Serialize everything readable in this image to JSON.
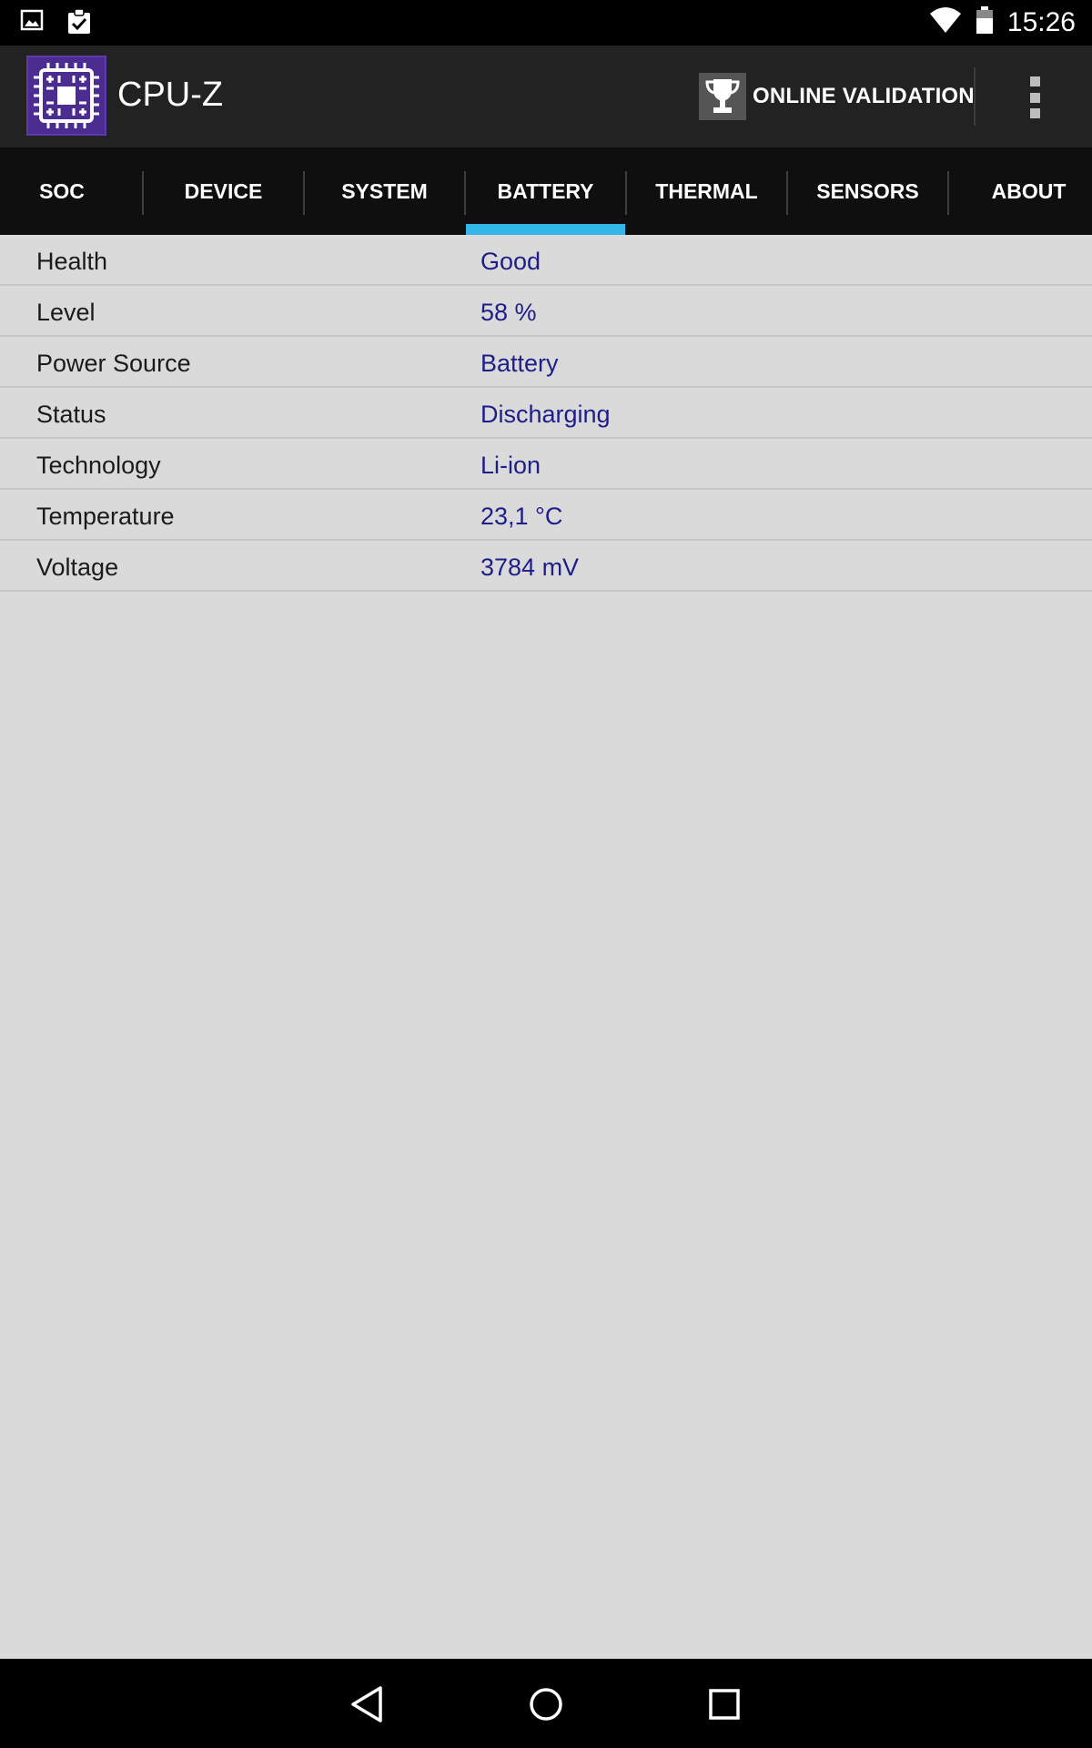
{
  "status_bar": {
    "time": "15:26",
    "icons": [
      "image-notification-icon",
      "clipboard-check-icon",
      "wifi-icon",
      "battery-icon"
    ]
  },
  "app_bar": {
    "title": "CPU-Z",
    "validation_label": "ONLINE VALIDATION",
    "logo_color": "#4b2d91"
  },
  "tabs": [
    {
      "label": "SOC"
    },
    {
      "label": "DEVICE"
    },
    {
      "label": "SYSTEM"
    },
    {
      "label": "BATTERY"
    },
    {
      "label": "THERMAL"
    },
    {
      "label": "SENSORS"
    },
    {
      "label": "ABOUT"
    }
  ],
  "active_tab": "BATTERY",
  "accent_color": "#33b5e5",
  "battery": {
    "rows": [
      {
        "label": "Health",
        "value": "Good"
      },
      {
        "label": "Level",
        "value": "58 %"
      },
      {
        "label": "Power Source",
        "value": "Battery"
      },
      {
        "label": "Status",
        "value": "Discharging"
      },
      {
        "label": "Technology",
        "value": "Li-ion"
      },
      {
        "label": "Temperature",
        "value": "23,1 °C"
      },
      {
        "label": "Voltage",
        "value": "3784 mV"
      }
    ]
  },
  "nav_bar": {
    "buttons": [
      "back-icon",
      "home-icon",
      "recents-icon"
    ]
  }
}
